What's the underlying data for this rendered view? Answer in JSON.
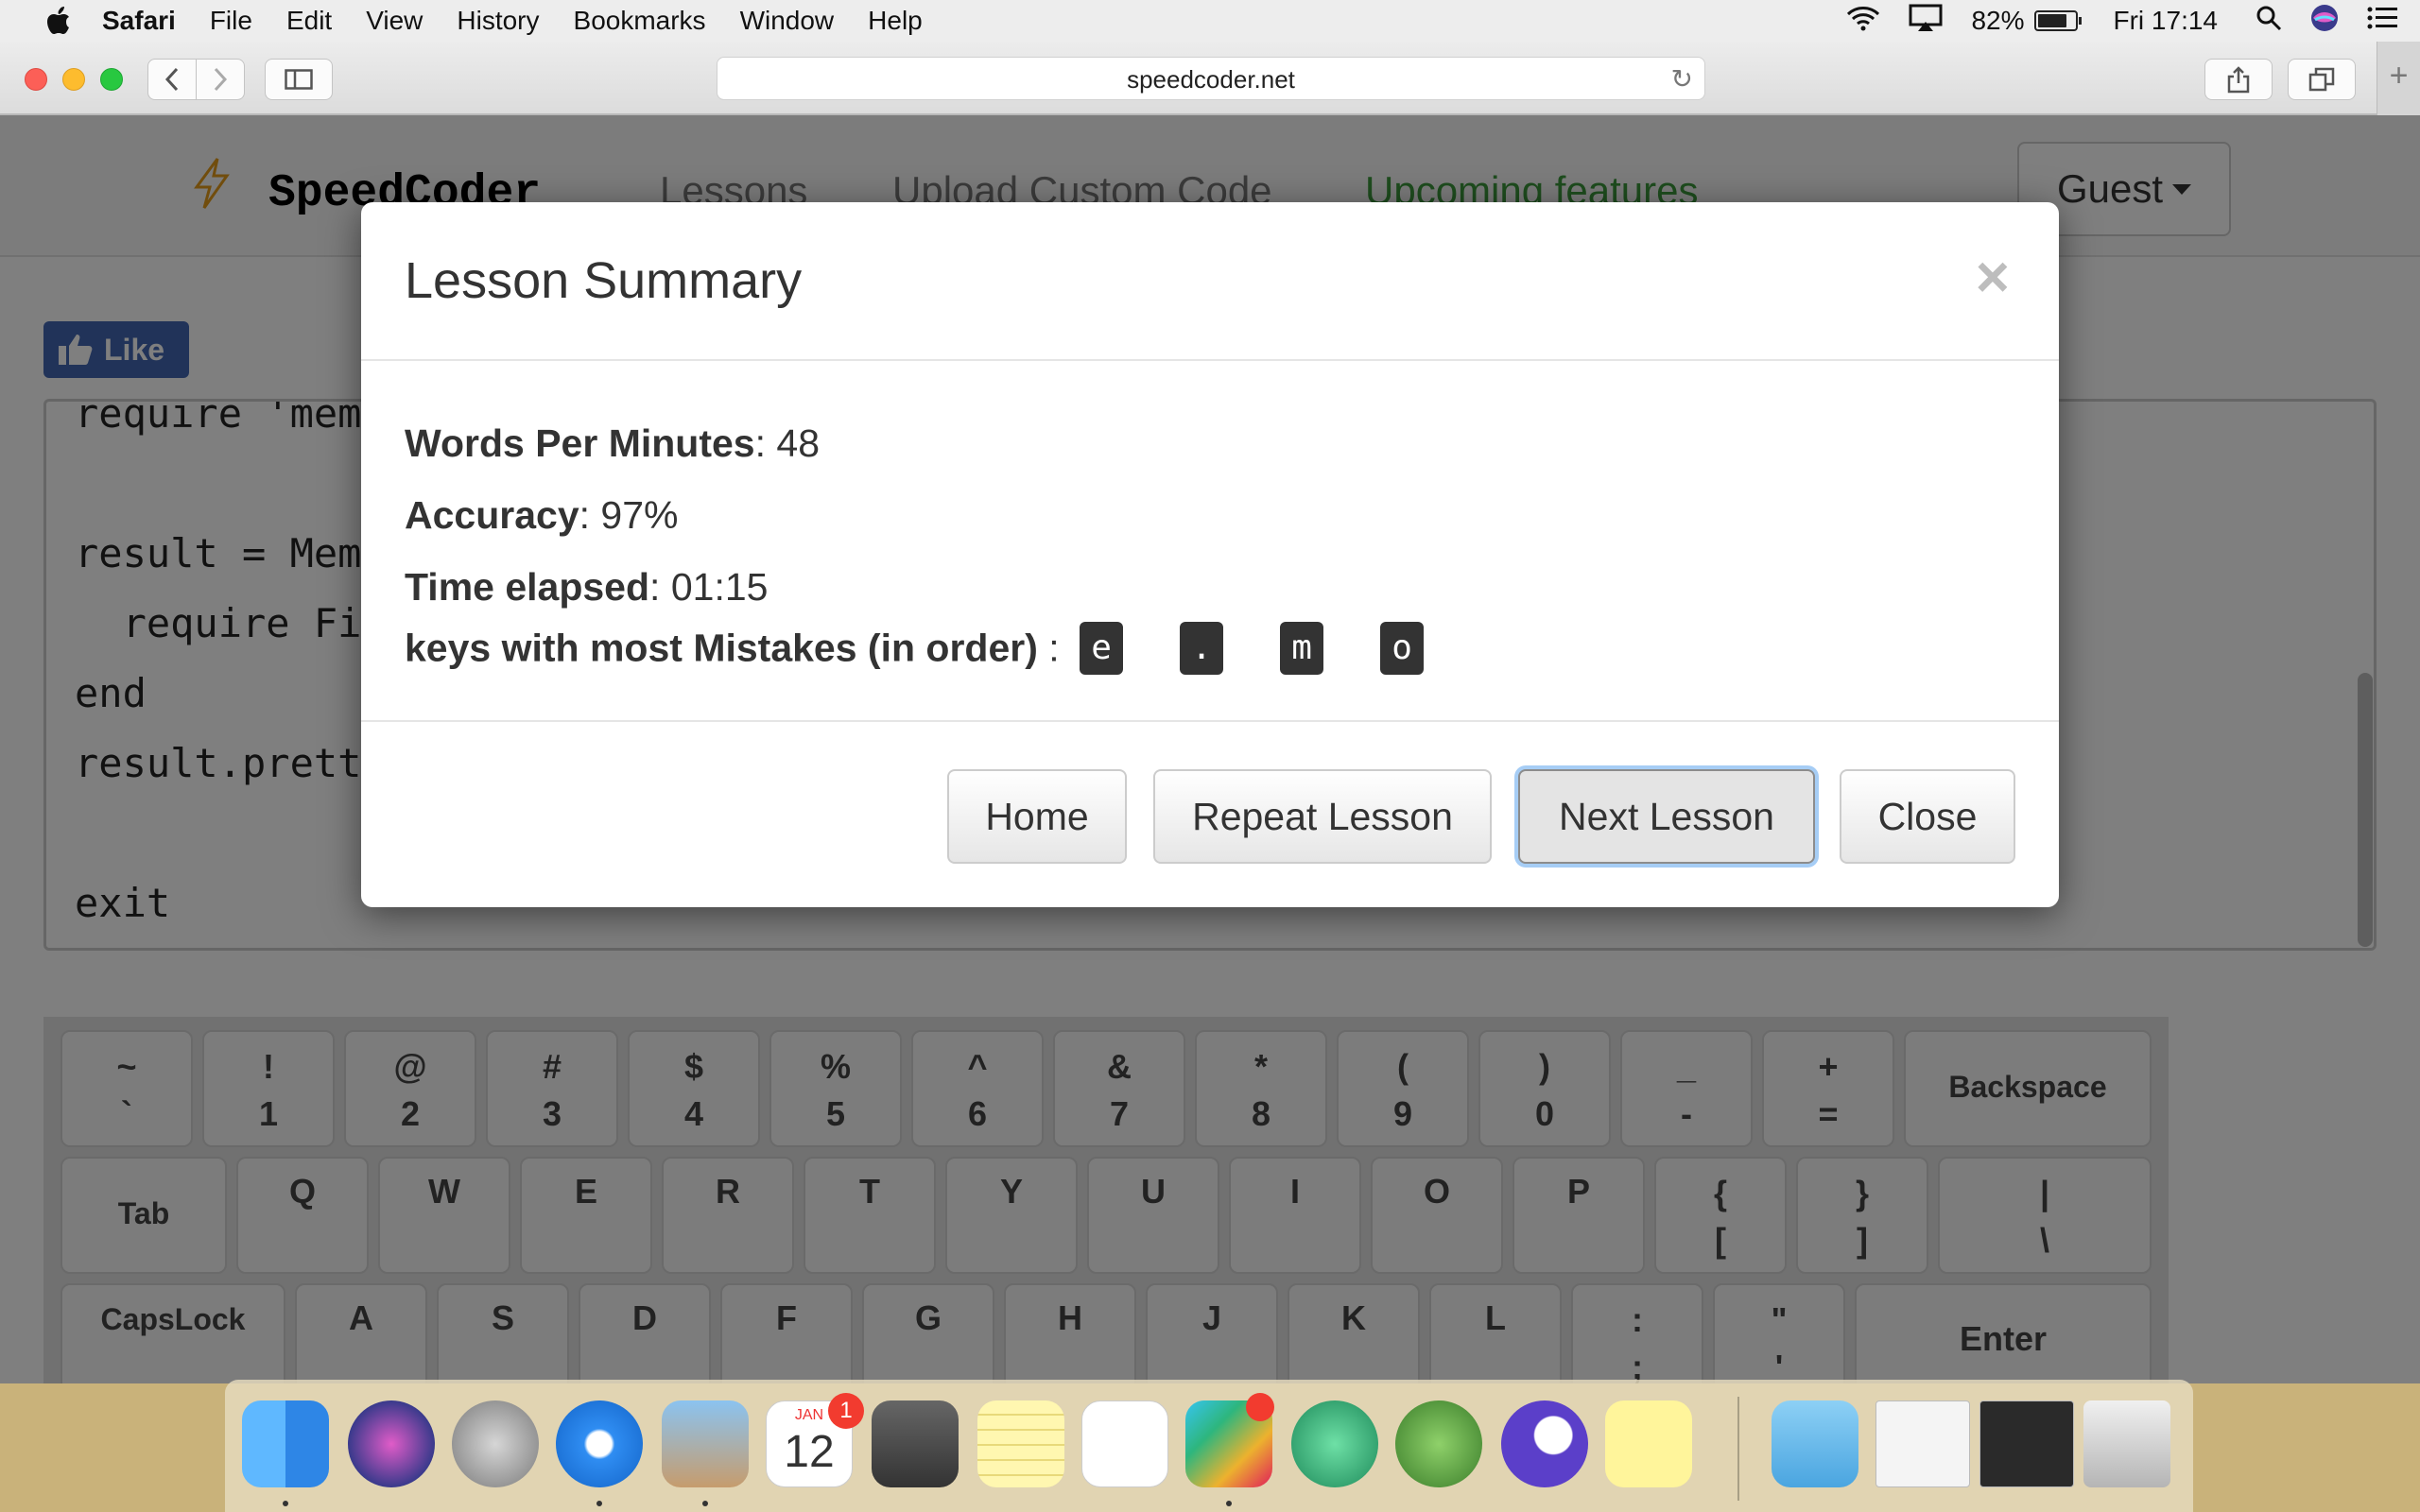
{
  "menubar": {
    "app_name": "Safari",
    "menus": [
      "File",
      "Edit",
      "View",
      "History",
      "Bookmarks",
      "Window",
      "Help"
    ],
    "battery_percent": "82%",
    "clock": "Fri 17:14"
  },
  "browser": {
    "url": "speedcoder.net"
  },
  "site": {
    "brand": "SpeedCoder",
    "nav": [
      "Lessons",
      "Upload Custom Code",
      "Upcoming features"
    ],
    "user_menu": "Guest",
    "like_button": "Like"
  },
  "editor": {
    "lines": [
      "require 'mem",
      "",
      "result = Mem",
      "  require Fi",
      "end",
      "result.prett",
      "",
      "exit"
    ]
  },
  "keyboard": {
    "row1": [
      {
        "top": "~",
        "bottom": "`"
      },
      {
        "top": "!",
        "bottom": "1"
      },
      {
        "top": "@",
        "bottom": "2"
      },
      {
        "top": "#",
        "bottom": "3"
      },
      {
        "top": "$",
        "bottom": "4"
      },
      {
        "top": "%",
        "bottom": "5"
      },
      {
        "top": "^",
        "bottom": "6"
      },
      {
        "top": "&",
        "bottom": "7"
      },
      {
        "top": "*",
        "bottom": "8"
      },
      {
        "top": "(",
        "bottom": "9"
      },
      {
        "top": ")",
        "bottom": "0"
      },
      {
        "top": "_",
        "bottom": "-"
      },
      {
        "top": "+",
        "bottom": "="
      }
    ],
    "backspace": "Backspace",
    "tab": "Tab",
    "row2": [
      "Q",
      "W",
      "E",
      "R",
      "T",
      "Y",
      "U",
      "I",
      "O",
      "P"
    ],
    "row2_symbols": [
      {
        "top": "{",
        "bottom": "["
      },
      {
        "top": "}",
        "bottom": "]"
      },
      {
        "top": "|",
        "bottom": "\\"
      }
    ],
    "capslock": "CapsLock",
    "row3": [
      "A",
      "S",
      "D",
      "F",
      "G",
      "H",
      "J",
      "K",
      "L"
    ],
    "row3_symbols": [
      {
        "top": ":",
        "bottom": ";"
      },
      {
        "top": "\"",
        "bottom": "'"
      }
    ],
    "enter": "Enter"
  },
  "modal": {
    "title": "Lesson Summary",
    "close_icon": "×",
    "wpm_label": "Words Per Minutes",
    "wpm_value": "48",
    "accuracy_label": "Accuracy",
    "accuracy_value": "97%",
    "time_label": "Time elapsed",
    "time_value": "01:15",
    "mistakes_label": "keys with most Mistakes (in order)",
    "mistake_keys": [
      "e",
      ".",
      "m",
      "o"
    ],
    "buttons": {
      "home": "Home",
      "repeat": "Repeat Lesson",
      "next": "Next Lesson",
      "close": "Close"
    }
  },
  "dock": {
    "apps": [
      "finder",
      "siri",
      "launchpad",
      "safari",
      "mail",
      "calendar",
      "calculator",
      "notes",
      "reminders",
      "slack",
      "atom",
      "android-studio",
      "unknown-app",
      "stickies",
      "downloads",
      "window-preview-1",
      "window-preview-2",
      "trash"
    ],
    "calendar_month": "JAN",
    "calendar_day": "12",
    "calendar_badge": "1"
  }
}
